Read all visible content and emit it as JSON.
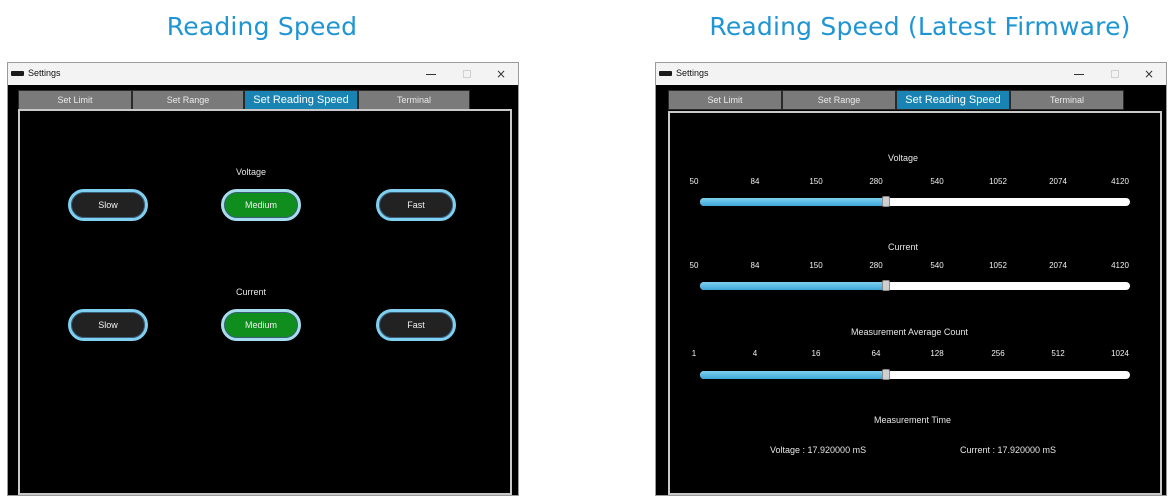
{
  "headings": {
    "left": "Reading Speed",
    "right": "Reading Speed (Latest Firmware)"
  },
  "window": {
    "title": "Settings",
    "minimize_glyph": "–",
    "maximize_glyph": "□",
    "close_glyph": "×"
  },
  "tabs": [
    "Set Limit",
    "Set Range",
    "Set Reading Speed",
    "Terminal"
  ],
  "active_tab": "Set Reading Speed",
  "left_panel": {
    "voltage": {
      "label": "Voltage",
      "options": [
        "Slow",
        "Medium",
        "Fast"
      ],
      "selected": "Medium"
    },
    "current": {
      "label": "Current",
      "options": [
        "Slow",
        "Medium",
        "Fast"
      ],
      "selected": "Medium"
    }
  },
  "right_panel": {
    "voltage": {
      "label": "Voltage",
      "ticks": [
        "50",
        "84",
        "150",
        "280",
        "540",
        "1052",
        "2074",
        "4120"
      ],
      "value": "280"
    },
    "current": {
      "label": "Current",
      "ticks": [
        "50",
        "84",
        "150",
        "280",
        "540",
        "1052",
        "2074",
        "4120"
      ],
      "value": "280"
    },
    "average": {
      "label": "Measurement Average Count",
      "ticks": [
        "1",
        "4",
        "16",
        "64",
        "128",
        "256",
        "512",
        "1024"
      ],
      "value": "64"
    },
    "time": {
      "label": "Measurement Time",
      "voltage_text": "Voltage :  17.920000  mS",
      "current_text": "Current :  17.920000  mS"
    }
  },
  "colors": {
    "heading": "#1f95d3",
    "active_tab": "#1984b4",
    "selected_button": "#0f8e1e",
    "slider_fill": "#4fb6e2"
  },
  "icons": [
    "app-icon",
    "minimize-icon",
    "maximize-icon",
    "close-icon"
  ]
}
